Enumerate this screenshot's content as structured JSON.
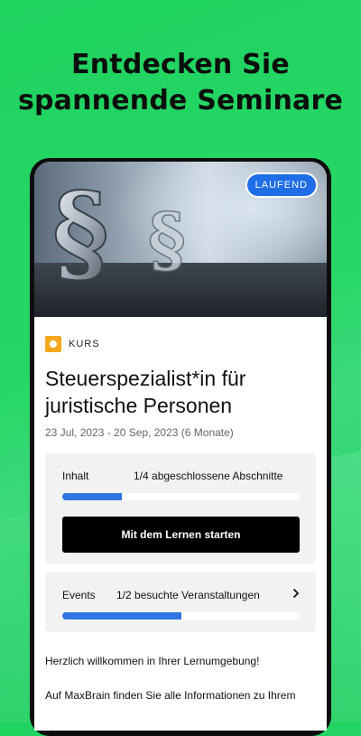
{
  "headline": {
    "line1": "Entdecken Sie",
    "line2": "spannende Seminare"
  },
  "card": {
    "badge": "LAUFEND",
    "type_label": "KURS",
    "title": "Steuerspezialist*in für juristische Personen",
    "dates": "23 Jul, 2023 - 20 Sep, 2023 (6 Monate)",
    "content": {
      "label": "Inhalt",
      "status": "1/4 abgeschlossene Abschnitte",
      "progress": 0.25,
      "button": "Mit dem Lernen starten"
    },
    "events": {
      "label": "Events",
      "status": "1/2 besuchte Veranstaltungen",
      "progress": 0.5
    },
    "welcome": "Herzlich willkommen in Ihrer Lernumgebung!",
    "info": "Auf MaxBrain finden Sie alle Informationen zu Ihrem"
  },
  "colors": {
    "background": "#27d766",
    "badge": "#1f6ee8",
    "progress": "#2f76e0",
    "type_icon": "#f4a81d"
  },
  "icons": {
    "type": "course-icon",
    "events_arrow": "chevron-right-icon"
  }
}
